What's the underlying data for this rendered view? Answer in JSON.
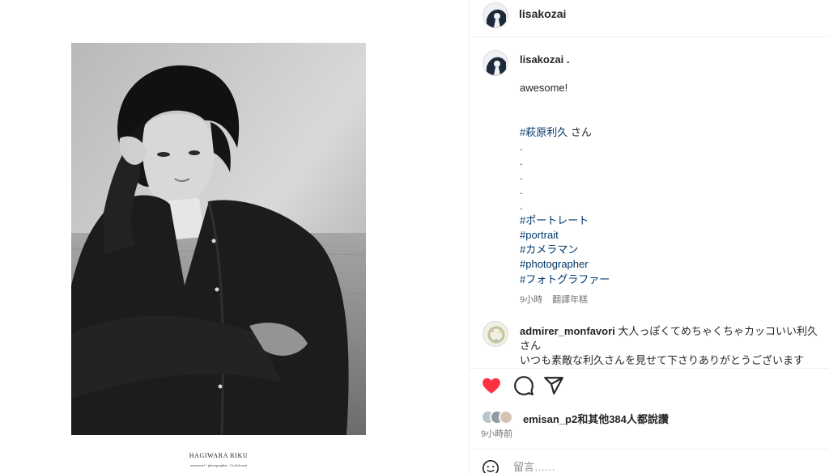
{
  "photo": {
    "alt_caption_title": "HAGIWARA RIKU",
    "alt_caption_sub": "awesome! / photographer : LisAckozai"
  },
  "header": {
    "username": "lisakozai"
  },
  "post": {
    "username": "lisakozai",
    "username_suffix": " .",
    "lines": [
      {
        "text": "awesome!",
        "kind": "text"
      },
      {
        "text": " ",
        "kind": "text"
      },
      {
        "text": " ",
        "kind": "text"
      },
      {
        "text": "#萩原利久",
        "kind": "tag",
        "after": " さん"
      },
      {
        "text": ".",
        "kind": "text"
      },
      {
        "text": ".",
        "kind": "text"
      },
      {
        "text": ".",
        "kind": "text"
      },
      {
        "text": ".",
        "kind": "text"
      },
      {
        "text": ".",
        "kind": "text"
      },
      {
        "text": "#ポートレート",
        "kind": "tag"
      },
      {
        "text": "#portrait",
        "kind": "tag"
      },
      {
        "text": "#カメラマン",
        "kind": "tag"
      },
      {
        "text": "#photographer",
        "kind": "tag"
      },
      {
        "text": "#フォトグラファー",
        "kind": "tag"
      }
    ],
    "time": "9小時",
    "translate": "翻譯年糕"
  },
  "comment": {
    "username": "admirer_monfavori",
    "text": " 大人っぽくてめちゃくちゃカッコいい利久さん",
    "text_line2": "いつも素敵な利久さんを見せて下さりありがとうございます"
  },
  "actions": {
    "liked": true,
    "like_color": "#ff3040",
    "likes_text": "emisan_p2和其他384人都說讚",
    "time_ago": "9小時前"
  },
  "add_comment": {
    "placeholder": "留言……"
  }
}
